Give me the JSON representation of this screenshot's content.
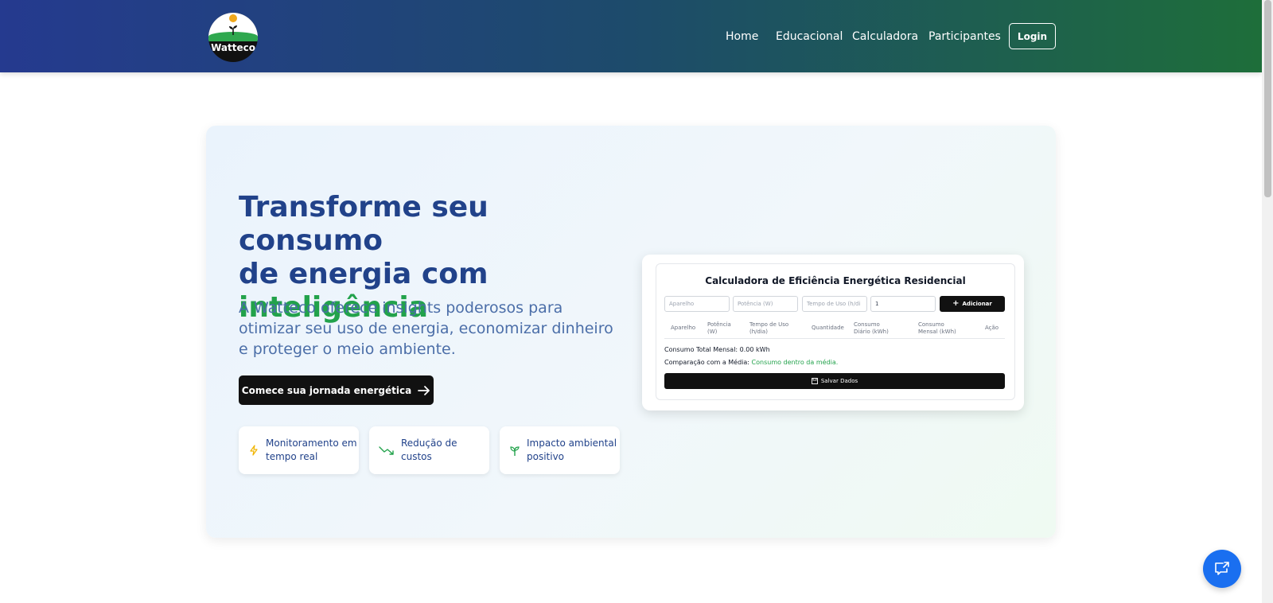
{
  "header": {
    "logo_text": "Watteco",
    "nav": [
      "Home",
      "Educacional",
      "Calculadora",
      "Participantes"
    ],
    "login_label": "Login"
  },
  "hero": {
    "headline_line1": "Transforme seu consumo",
    "headline_line2": "de energia com",
    "headline_highlight": "inteligência",
    "subtitle": "A Watteco oferece insights poderosos para otimizar seu uso de energia, economizar dinheiro e proteger o meio ambiente.",
    "cta_label": "Comece sua jornada energética",
    "features": [
      {
        "icon": "lightning-icon",
        "label": "Monitoramento em tempo real"
      },
      {
        "icon": "trending-down-icon",
        "label": "Redução de custos"
      },
      {
        "icon": "sprout-icon",
        "label": "Impacto ambiental positivo"
      }
    ]
  },
  "calculator": {
    "title": "Calculadora de Eficiência Energética Residencial",
    "inputs": {
      "appliance_placeholder": "Aparelho",
      "power_placeholder": "Potência (W)",
      "usage_placeholder": "Tempo de Uso (h/di",
      "quantity_value": "1"
    },
    "add_label": "Adicionar",
    "columns": [
      "Aparelho",
      "Potência (W)",
      "Tempo de Uso (h/dia)",
      "Quantidade",
      "Consumo Diário (kWh)",
      "Consumo Mensal (kWh)",
      "Ação"
    ],
    "total_text": "Consumo Total Mensal: 0.00 kWh",
    "comparison_label": "Comparação com a Média:",
    "comparison_value": "Consumo dentro da média.",
    "save_label": "Salvar Dados"
  },
  "colors": {
    "primary_blue": "#21428a",
    "accent_green": "#22a24b",
    "chat_blue": "#1a6ff0"
  }
}
